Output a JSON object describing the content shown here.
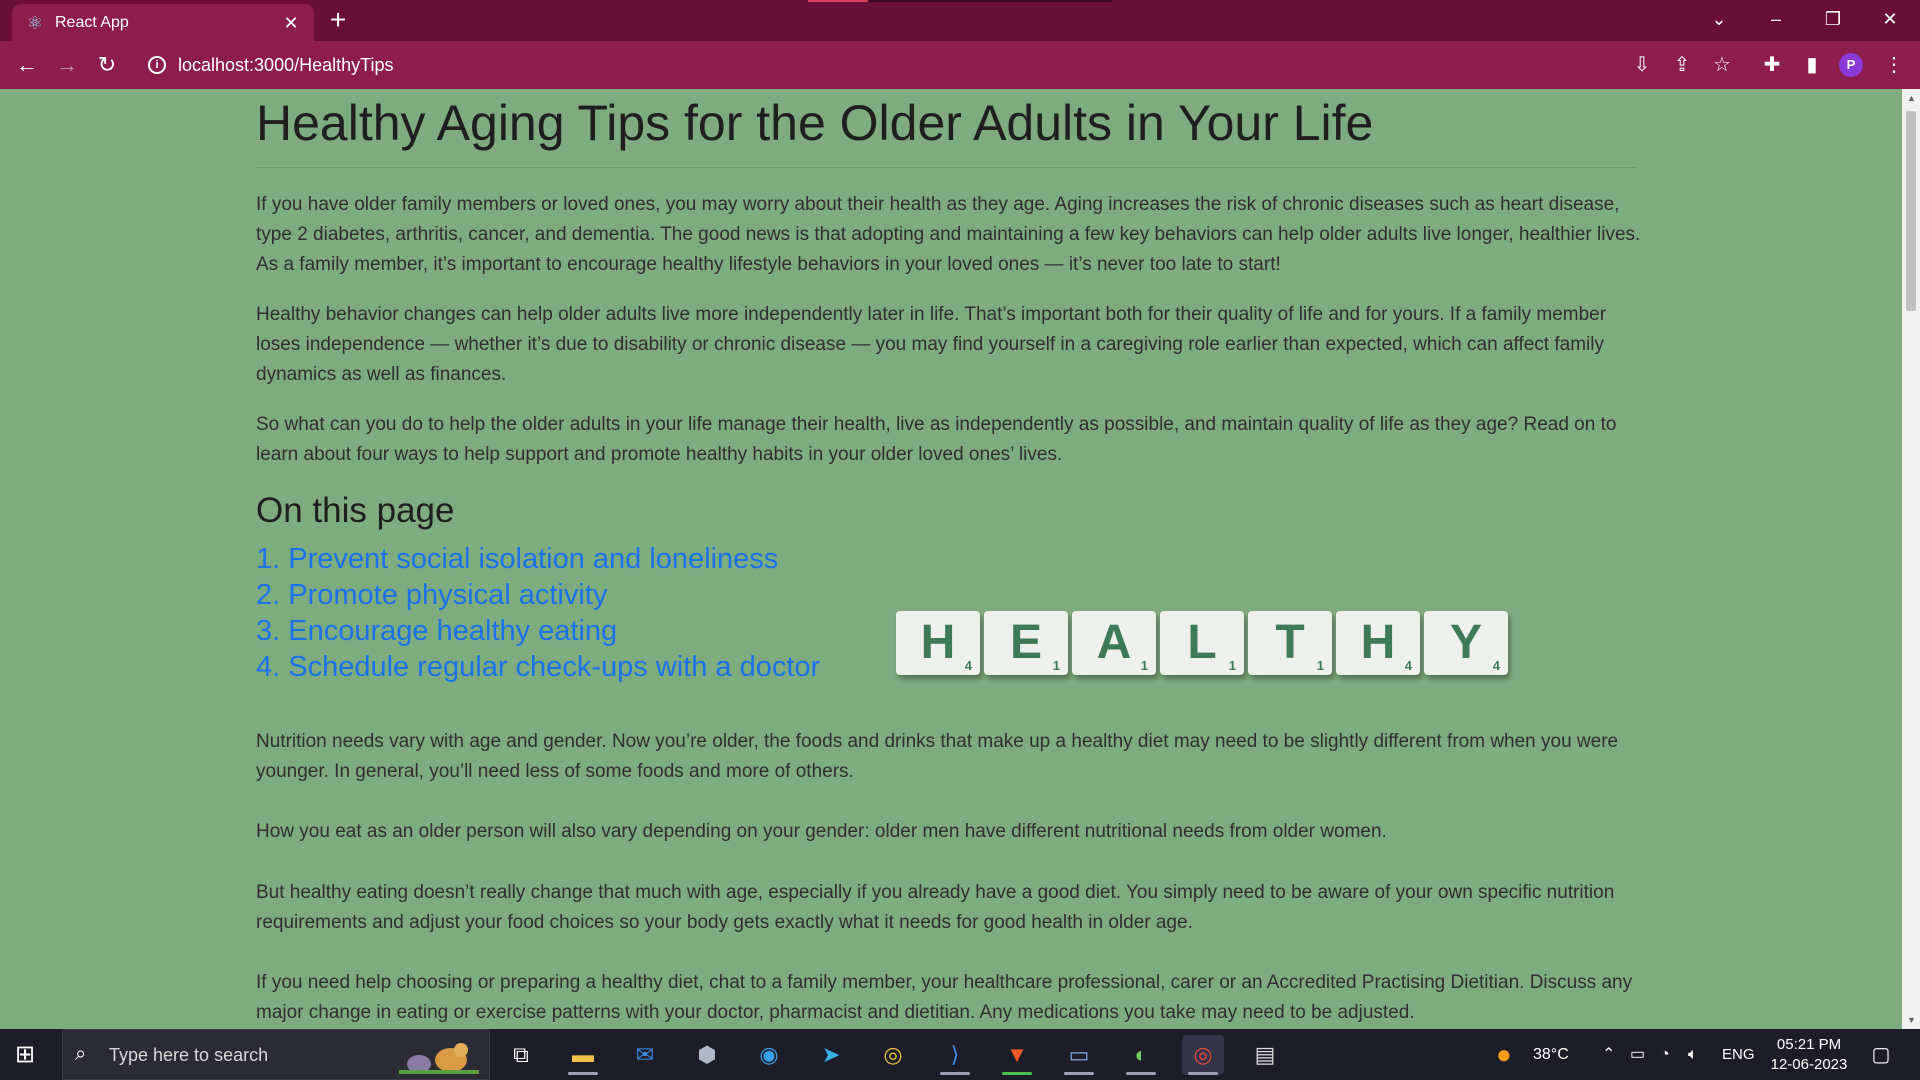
{
  "browser": {
    "tab_title": "React App",
    "new_tab_symbol": "+",
    "url": "localhost:3000/HealthyTips"
  },
  "article": {
    "title": "Healthy Aging Tips for the Older Adults in Your Life",
    "intro": [
      "If you have older family members or loved ones, you may worry about their health as they age. Aging increases the risk of chronic diseases such as heart disease, type 2 diabetes, arthritis, cancer, and dementia. The good news is that adopting and maintaining a few key behaviors can help older adults live longer, healthier lives. As a family member, it’s important to encourage healthy lifestyle behaviors in your loved ones — it’s never too late to start!",
      "Healthy behavior changes can help older adults live more independently later in life. That’s important both for their quality of life and for yours. If a family member loses independence — whether it’s due to disability or chronic disease — you may find yourself in a caregiving role earlier than expected, which can affect family dynamics as well as finances.",
      "So what can you do to help the older adults in your life manage their health, live as independently as possible, and maintain quality of life as they age? Read on to learn about four ways to help support and promote healthy habits in your older loved ones’ lives."
    ],
    "toc_heading": "On this page",
    "toc_links": [
      "1. Prevent social isolation and loneliness",
      "2. Promote physical activity",
      "3. Encourage healthy eating",
      "4. Schedule regular check-ups with a doctor"
    ],
    "tiles": [
      {
        "letter": "H",
        "score": "4"
      },
      {
        "letter": "E",
        "score": "1"
      },
      {
        "letter": "A",
        "score": "1"
      },
      {
        "letter": "L",
        "score": "1"
      },
      {
        "letter": "T",
        "score": "1"
      },
      {
        "letter": "H",
        "score": "4"
      },
      {
        "letter": "Y",
        "score": "4"
      }
    ],
    "nutrition": [
      "Nutrition needs vary with age and gender. Now you’re older, the foods and drinks that make up a healthy diet may need to be slightly different from when you were younger. In general, you’ll need less of some foods and more of others.",
      "How you eat as an older person will also vary depending on your gender: older men have different nutritional needs from older women.",
      "But healthy eating doesn’t really change that much with age, especially if you already have a good diet. You simply need to be aware of your own specific nutrition requirements and adjust your food choices so your body gets exactly what it needs for good health in older age.",
      "If you need help choosing or preparing a healthy diet, chat to a family member, your healthcare professional, carer or an Accredited Practising Dietitian. Discuss any major change in eating or exercise patterns with your doctor, pharmacist and dietitian. Any medications you take may need to be adjusted."
    ]
  },
  "taskbar": {
    "search_placeholder": "Type here to search",
    "weather": "38°C",
    "language": "ENG",
    "time": "05:21 PM",
    "date": "12-06-2023"
  },
  "colors": {
    "titlebar": "#680e39",
    "toolbar": "#8c1d4d",
    "page_background": "#7fac7f",
    "link": "#1a73e8"
  }
}
